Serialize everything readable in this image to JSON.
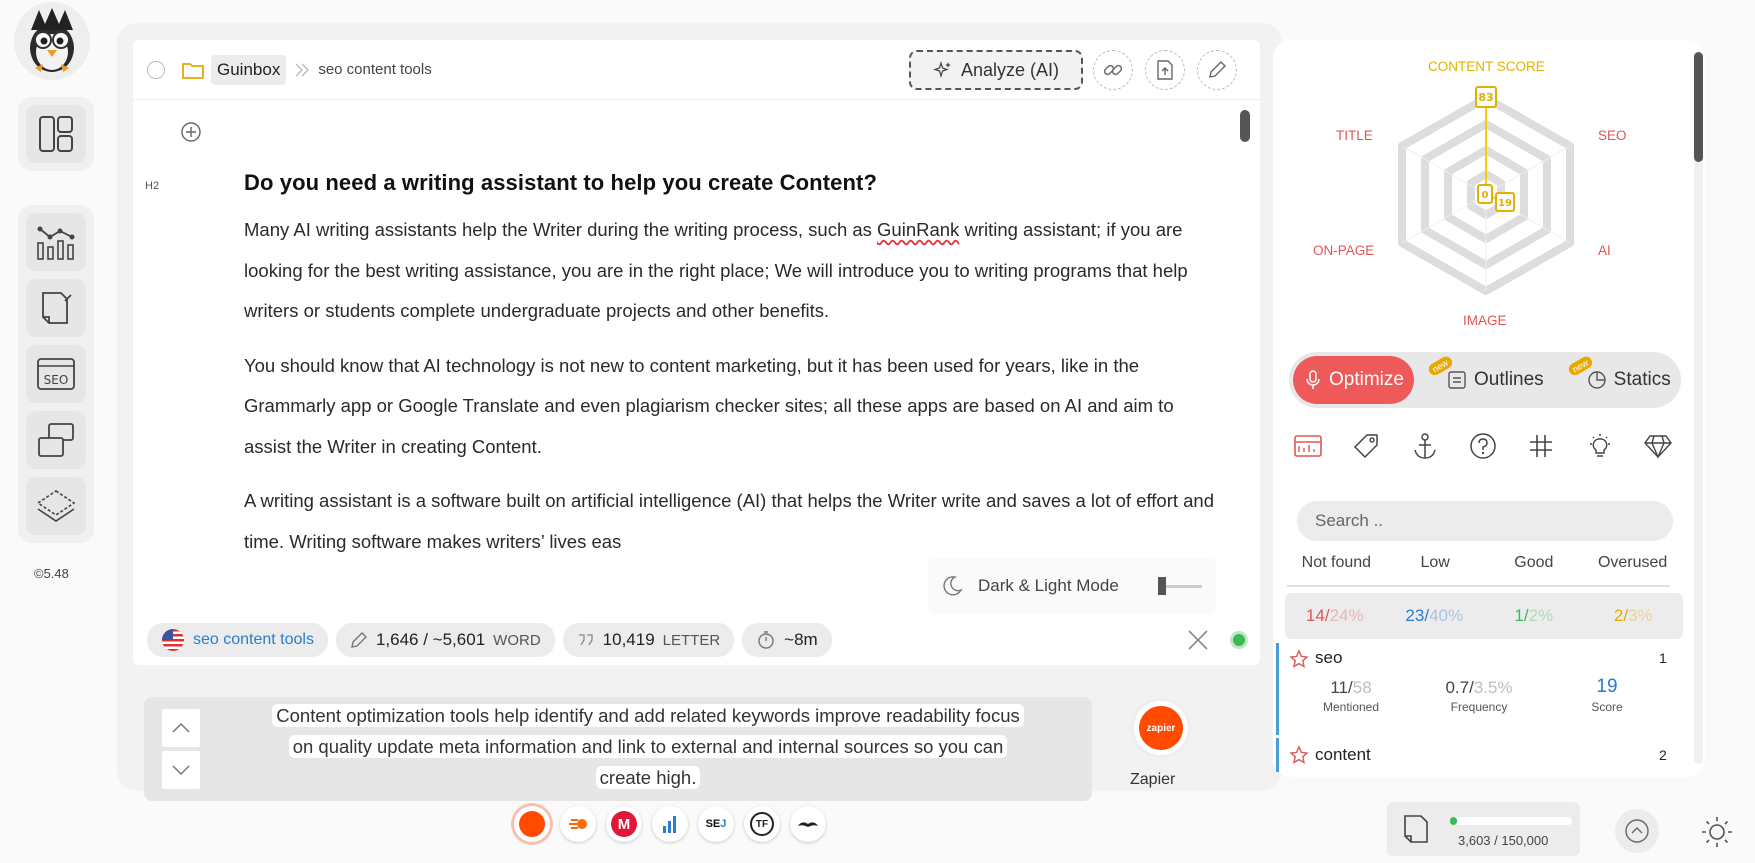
{
  "app": {
    "version": "©5.48"
  },
  "editor": {
    "breadcrumb_root": "Guinbox",
    "breadcrumb_page": "seo content tools",
    "analyze_label": "Analyze (AI)",
    "block_type": "H2",
    "heading": "Do you need a writing assistant to help you create Content?",
    "paragraphs": [
      {
        "before": "Many AI writing assistants help the Writer during the writing process, such as ",
        "flagged": "GuinRank",
        "after": " writing assistant; if you are looking for the best writing assistance, you are in the right place; We will introduce you to writing programs that help writers or students complete undergraduate projects and other benefits."
      },
      {
        "text": "You should know that AI technology is not new to content marketing, but it has been used for years, like in the Grammarly app or Google Translate and even plagiarism checker sites; all these apps are based on AI and aim to assist the Writer in creating Content."
      },
      {
        "text": "A writing assistant is a software built on artificial intelligence (AI) that helps the Writer write and saves a lot of effort and time. Writing software makes writers’ lives eas"
      }
    ],
    "dark_light_label": "Dark & Light Mode"
  },
  "status": {
    "keyword": "seo content tools",
    "word_count": "1,646 / ~5,601",
    "word_unit": "WORD",
    "letter_count": "10,419",
    "letter_unit": "LETTER",
    "read_time": "~8m"
  },
  "suggestion": {
    "text_line1": "Content optimization tools help identify and add related keywords improve readability focus",
    "text_line2": "on quality update meta information and link to external and internal sources so you can",
    "text_line3": "create high."
  },
  "integration": {
    "zapier_label": "Zapier",
    "zapier_logo_text": "zapier"
  },
  "integrations_row": [
    "zapier",
    "rocket",
    "M",
    "bars",
    "SEJ",
    "TF",
    "mustache"
  ],
  "radar": {
    "labels": {
      "top": "CONTENT SCORE",
      "top_left": "TITLE",
      "top_right": "SEO",
      "bottom_left": "ON-PAGE",
      "bottom_right": "AI",
      "bottom": "IMAGE"
    },
    "score_badge": "83",
    "inner_badge_1": "0",
    "inner_badge_2": "19",
    "colors": {
      "score": "#e2b100",
      "label": "#e05656"
    }
  },
  "tabs": {
    "optimize": "Optimize",
    "outlines": "Outlines",
    "statics": "Statics",
    "new_badge": "new"
  },
  "right_search": {
    "placeholder": "Search .."
  },
  "filters": {
    "headers": [
      "Not found",
      "Low",
      "Good",
      "Overused"
    ],
    "not_found": {
      "count": "14",
      "pct": "24%",
      "color": "#e05656"
    },
    "low": {
      "count": "23",
      "pct": "40%",
      "color": "#2a7ccf"
    },
    "good": {
      "count": "1",
      "pct": "2%",
      "color": "#3cba54"
    },
    "overused": {
      "count": "2",
      "pct": "3%",
      "color": "#e8a800"
    }
  },
  "keywords": [
    {
      "name": "seo",
      "index": "1",
      "mentioned": "11",
      "mentioned_target": "58",
      "mentioned_label": "Mentioned",
      "frequency": "0.7",
      "frequency_target": "3.5%",
      "frequency_label": "Frequency",
      "score": "19",
      "score_label": "Score"
    },
    {
      "name": "content",
      "index": "2"
    }
  ],
  "quota": {
    "text": "3,603 / 150,000",
    "fraction": 0.024
  }
}
